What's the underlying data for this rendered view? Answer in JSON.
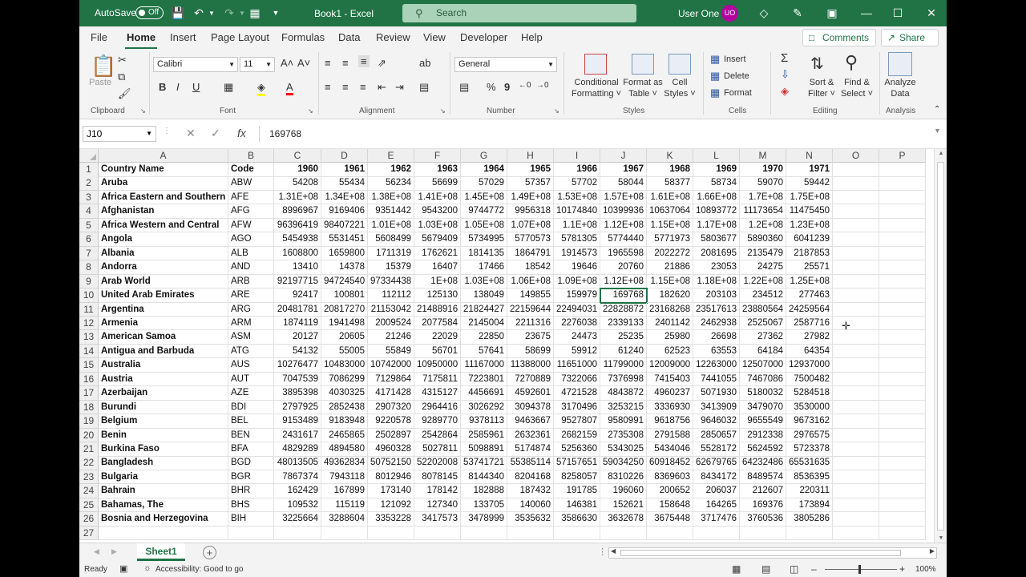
{
  "titlebar": {
    "autosave_label": "AutoSave",
    "autosave_state": "Off",
    "doc_title": "Book1  -  Excel",
    "search_placeholder": "Search",
    "user_name": "User One",
    "user_initials": "UO"
  },
  "tabs": [
    "File",
    "Home",
    "Insert",
    "Page Layout",
    "Formulas",
    "Data",
    "Review",
    "View",
    "Developer",
    "Help"
  ],
  "active_tab": "Home",
  "comments_label": "Comments",
  "share_label": "Share",
  "ribbon": {
    "clipboard": {
      "label": "Clipboard",
      "paste": "Paste"
    },
    "font": {
      "label": "Font",
      "font_name": "Calibri",
      "font_size": "11"
    },
    "alignment": {
      "label": "Alignment"
    },
    "number": {
      "label": "Number",
      "format": "General"
    },
    "styles": {
      "label": "Styles",
      "conditional1": "Conditional",
      "conditional2": "Formatting",
      "format_as1": "Format as",
      "format_as2": "Table",
      "cell_styles1": "Cell",
      "cell_styles2": "Styles"
    },
    "cells": {
      "label": "Cells",
      "insert": "Insert",
      "delete": "Delete",
      "format": "Format"
    },
    "editing": {
      "label": "Editing",
      "sort1": "Sort &",
      "sort2": "Filter",
      "find1": "Find &",
      "find2": "Select"
    },
    "analysis": {
      "label": "Analysis",
      "analyze1": "Analyze",
      "analyze2": "Data"
    }
  },
  "formula_bar": {
    "name_box": "J10",
    "formula": "169768"
  },
  "columns": [
    "A",
    "B",
    "C",
    "D",
    "E",
    "F",
    "G",
    "H",
    "I",
    "J",
    "K",
    "L",
    "M",
    "N",
    "O",
    "P"
  ],
  "rows": [
    [
      "Country Name",
      "Code",
      "1960",
      "1961",
      "1962",
      "1963",
      "1964",
      "1965",
      "1966",
      "1967",
      "1968",
      "1969",
      "1970",
      "1971"
    ],
    [
      "Aruba",
      "ABW",
      "54208",
      "55434",
      "56234",
      "56699",
      "57029",
      "57357",
      "57702",
      "58044",
      "58377",
      "58734",
      "59070",
      "59442"
    ],
    [
      "Africa Eastern and Southern",
      "AFE",
      "1.31E+08",
      "1.34E+08",
      "1.38E+08",
      "1.41E+08",
      "1.45E+08",
      "1.49E+08",
      "1.53E+08",
      "1.57E+08",
      "1.61E+08",
      "1.66E+08",
      "1.7E+08",
      "1.75E+08"
    ],
    [
      "Afghanistan",
      "AFG",
      "8996967",
      "9169406",
      "9351442",
      "9543200",
      "9744772",
      "9956318",
      "10174840",
      "10399936",
      "10637064",
      "10893772",
      "11173654",
      "11475450"
    ],
    [
      "Africa Western and Central",
      "AFW",
      "96396419",
      "98407221",
      "1.01E+08",
      "1.03E+08",
      "1.05E+08",
      "1.07E+08",
      "1.1E+08",
      "1.12E+08",
      "1.15E+08",
      "1.17E+08",
      "1.2E+08",
      "1.23E+08"
    ],
    [
      "Angola",
      "AGO",
      "5454938",
      "5531451",
      "5608499",
      "5679409",
      "5734995",
      "5770573",
      "5781305",
      "5774440",
      "5771973",
      "5803677",
      "5890360",
      "6041239"
    ],
    [
      "Albania",
      "ALB",
      "1608800",
      "1659800",
      "1711319",
      "1762621",
      "1814135",
      "1864791",
      "1914573",
      "1965598",
      "2022272",
      "2081695",
      "2135479",
      "2187853"
    ],
    [
      "Andorra",
      "AND",
      "13410",
      "14378",
      "15379",
      "16407",
      "17466",
      "18542",
      "19646",
      "20760",
      "21886",
      "23053",
      "24275",
      "25571"
    ],
    [
      "Arab World",
      "ARB",
      "92197715",
      "94724540",
      "97334438",
      "1E+08",
      "1.03E+08",
      "1.06E+08",
      "1.09E+08",
      "1.12E+08",
      "1.15E+08",
      "1.18E+08",
      "1.22E+08",
      "1.25E+08"
    ],
    [
      "United Arab Emirates",
      "ARE",
      "92417",
      "100801",
      "112112",
      "125130",
      "138049",
      "149855",
      "159979",
      "169768",
      "182620",
      "203103",
      "234512",
      "277463"
    ],
    [
      "Argentina",
      "ARG",
      "20481781",
      "20817270",
      "21153042",
      "21488916",
      "21824427",
      "22159644",
      "22494031",
      "22828872",
      "23168268",
      "23517613",
      "23880564",
      "24259564"
    ],
    [
      "Armenia",
      "ARM",
      "1874119",
      "1941498",
      "2009524",
      "2077584",
      "2145004",
      "2211316",
      "2276038",
      "2339133",
      "2401142",
      "2462938",
      "2525067",
      "2587716"
    ],
    [
      "American Samoa",
      "ASM",
      "20127",
      "20605",
      "21246",
      "22029",
      "22850",
      "23675",
      "24473",
      "25235",
      "25980",
      "26698",
      "27362",
      "27982"
    ],
    [
      "Antigua and Barbuda",
      "ATG",
      "54132",
      "55005",
      "55849",
      "56701",
      "57641",
      "58699",
      "59912",
      "61240",
      "62523",
      "63553",
      "64184",
      "64354"
    ],
    [
      "Australia",
      "AUS",
      "10276477",
      "10483000",
      "10742000",
      "10950000",
      "11167000",
      "11388000",
      "11651000",
      "11799000",
      "12009000",
      "12263000",
      "12507000",
      "12937000"
    ],
    [
      "Austria",
      "AUT",
      "7047539",
      "7086299",
      "7129864",
      "7175811",
      "7223801",
      "7270889",
      "7322066",
      "7376998",
      "7415403",
      "7441055",
      "7467086",
      "7500482"
    ],
    [
      "Azerbaijan",
      "AZE",
      "3895398",
      "4030325",
      "4171428",
      "4315127",
      "4456691",
      "4592601",
      "4721528",
      "4843872",
      "4960237",
      "5071930",
      "5180032",
      "5284518"
    ],
    [
      "Burundi",
      "BDI",
      "2797925",
      "2852438",
      "2907320",
      "2964416",
      "3026292",
      "3094378",
      "3170496",
      "3253215",
      "3336930",
      "3413909",
      "3479070",
      "3530000"
    ],
    [
      "Belgium",
      "BEL",
      "9153489",
      "9183948",
      "9220578",
      "9289770",
      "9378113",
      "9463667",
      "9527807",
      "9580991",
      "9618756",
      "9646032",
      "9655549",
      "9673162"
    ],
    [
      "Benin",
      "BEN",
      "2431617",
      "2465865",
      "2502897",
      "2542864",
      "2585961",
      "2632361",
      "2682159",
      "2735308",
      "2791588",
      "2850657",
      "2912338",
      "2976575"
    ],
    [
      "Burkina Faso",
      "BFA",
      "4829289",
      "4894580",
      "4960328",
      "5027811",
      "5098891",
      "5174874",
      "5256360",
      "5343025",
      "5434046",
      "5528172",
      "5624592",
      "5723378"
    ],
    [
      "Bangladesh",
      "BGD",
      "48013505",
      "49362834",
      "50752150",
      "52202008",
      "53741721",
      "55385114",
      "57157651",
      "59034250",
      "60918452",
      "62679765",
      "64232486",
      "65531635"
    ],
    [
      "Bulgaria",
      "BGR",
      "7867374",
      "7943118",
      "8012946",
      "8078145",
      "8144340",
      "8204168",
      "8258057",
      "8310226",
      "8369603",
      "8434172",
      "8489574",
      "8536395"
    ],
    [
      "Bahrain",
      "BHR",
      "162429",
      "167899",
      "173140",
      "178142",
      "182888",
      "187432",
      "191785",
      "196060",
      "200652",
      "206037",
      "212607",
      "220311"
    ],
    [
      "Bahamas, The",
      "BHS",
      "109532",
      "115119",
      "121092",
      "127340",
      "133705",
      "140060",
      "146381",
      "152621",
      "158648",
      "164265",
      "169376",
      "173894"
    ],
    [
      "Bosnia and Herzegovina",
      "BIH",
      "3225664",
      "3288604",
      "3353228",
      "3417573",
      "3478999",
      "3535632",
      "3586630",
      "3632678",
      "3675448",
      "3717476",
      "3760536",
      "3805286"
    ]
  ],
  "sheet_tab": "Sheet1",
  "status": {
    "ready": "Ready",
    "accessibility": "Accessibility: Good to go",
    "zoom": "100%"
  }
}
